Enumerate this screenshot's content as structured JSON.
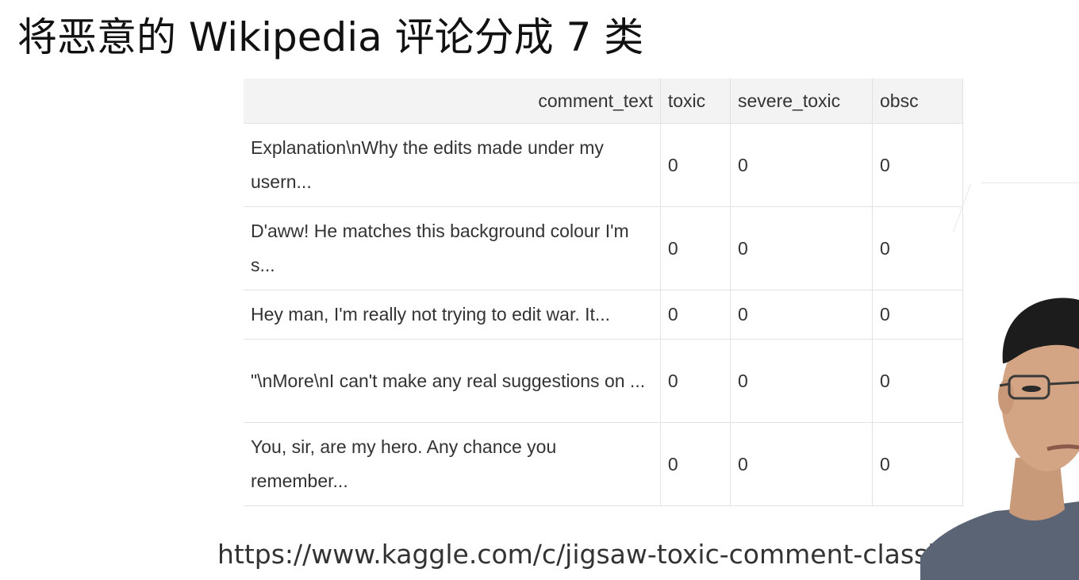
{
  "slide": {
    "title": "将恶意的 Wikipedia 评论分成 7 类",
    "source_url": "https://www.kaggle.com/c/jigsaw-toxic-comment-classification"
  },
  "table": {
    "columns": [
      "comment_text",
      "toxic",
      "severe_toxic",
      "obsc"
    ],
    "rows": [
      {
        "comment_text": "Explanation\\nWhy the edits made under my usern...",
        "toxic": "0",
        "severe_toxic": "0",
        "obscene": "0"
      },
      {
        "comment_text": "D'aww! He matches this background colour I'm s...",
        "toxic": "0",
        "severe_toxic": "0",
        "obscene": "0"
      },
      {
        "comment_text": "Hey man, I'm really not trying to edit war. It...",
        "toxic": "0",
        "severe_toxic": "0",
        "obscene": "0"
      },
      {
        "comment_text": "\"\\nMore\\nI can't make any real suggestions on ...",
        "toxic": "0",
        "severe_toxic": "0",
        "obscene": "0"
      },
      {
        "comment_text": "You, sir, are my hero. Any chance you remember...",
        "toxic": "0",
        "severe_toxic": "0",
        "obscene": "0"
      }
    ]
  },
  "colors": {
    "header_bg": "#f3f3f3",
    "border": "#e3e3e3",
    "text": "#333333"
  },
  "icons": {
    "presenter": "presenter-webcam-overlay"
  }
}
